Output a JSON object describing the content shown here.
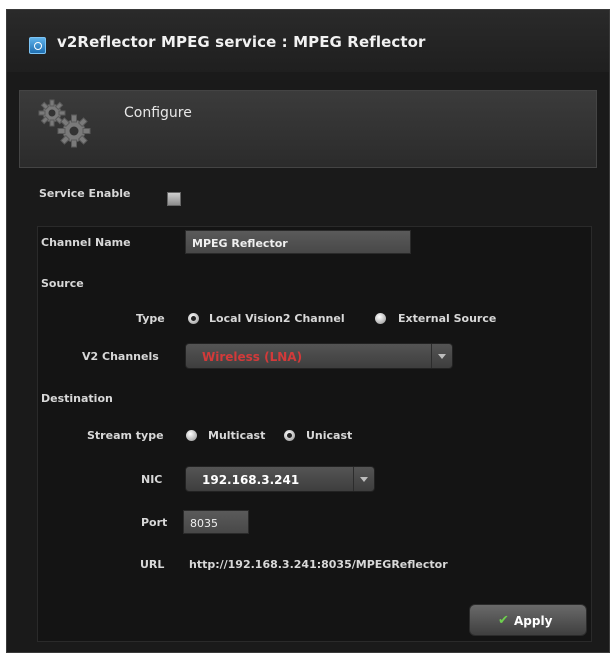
{
  "window": {
    "title": "v2Reflector MPEG service : MPEG Reflector"
  },
  "configure": {
    "label": "Configure"
  },
  "service": {
    "enable_label": "Service Enable",
    "enabled": false
  },
  "form": {
    "channel_name_label": "Channel Name",
    "channel_name_value": "MPEG Reflector",
    "source_heading": "Source",
    "type_label": "Type",
    "type_options": [
      "Local Vision2 Channel",
      "External Source"
    ],
    "type_selected": "Local Vision2 Channel",
    "v2_channels_label": "V2 Channels",
    "v2_channels_value": "Wireless (LNA)",
    "destination_heading": "Destination",
    "stream_type_label": "Stream type",
    "stream_type_options": [
      "Multicast",
      "Unicast"
    ],
    "stream_type_selected": "Unicast",
    "nic_label": "NIC",
    "nic_value": "192.168.3.241",
    "port_label": "Port",
    "port_value": "8035",
    "url_label": "URL",
    "url_value": "http://192.168.3.241:8035/MPEGReflector"
  },
  "actions": {
    "apply_label": "Apply",
    "apply_icon": "check-icon"
  },
  "colors": {
    "background": "#1a1a1a",
    "accent": "#2a7fc8",
    "alert_text": "#d23a3a",
    "apply_check": "#6ed04e"
  }
}
